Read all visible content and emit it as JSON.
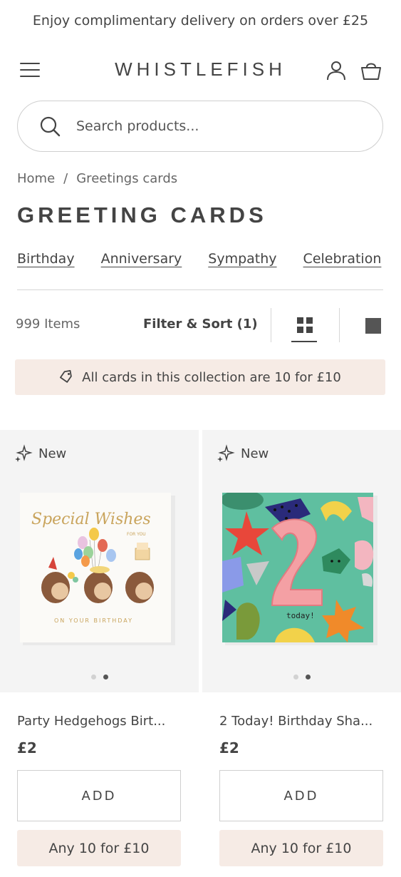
{
  "announcement": "Enjoy complimentary delivery on orders over £25",
  "header": {
    "logo": "WHISTLEFISH",
    "icons": [
      "menu-icon",
      "account-icon",
      "bag-icon"
    ]
  },
  "search": {
    "placeholder": "Search products..."
  },
  "breadcrumb": {
    "home": "Home",
    "separator": "/",
    "current": "Greetings cards"
  },
  "page_title": "GREETING CARDS",
  "subnav": [
    "Birthday",
    "Anniversary",
    "Sympathy",
    "Celebration"
  ],
  "toolbar": {
    "count": "999 Items",
    "filter": "Filter & Sort (1)",
    "active_view": "grid"
  },
  "promo": {
    "text": "All cards in this collection are 10 for £10",
    "icon": "tag-icon"
  },
  "products": [
    {
      "badge": "New",
      "name": "Party Hedgehogs Birt...",
      "price": "£2",
      "add_label": "ADD",
      "offer_label": "Any 10 for £10",
      "card_text": [
        "Special Wishes",
        "FOR YOU",
        "ON YOUR BIRTHDAY"
      ],
      "active_image": 2,
      "image_count": 2
    },
    {
      "badge": "New",
      "name": "2 Today! Birthday Sha...",
      "price": "£2",
      "add_label": "ADD",
      "offer_label": "Any 10 for £10",
      "card_text": [
        "today!"
      ],
      "active_image": 2,
      "image_count": 2
    }
  ],
  "colors": {
    "accent_bg": "#f6ebe5",
    "text": "#444444",
    "tile_bg": "#f4f4f4"
  }
}
